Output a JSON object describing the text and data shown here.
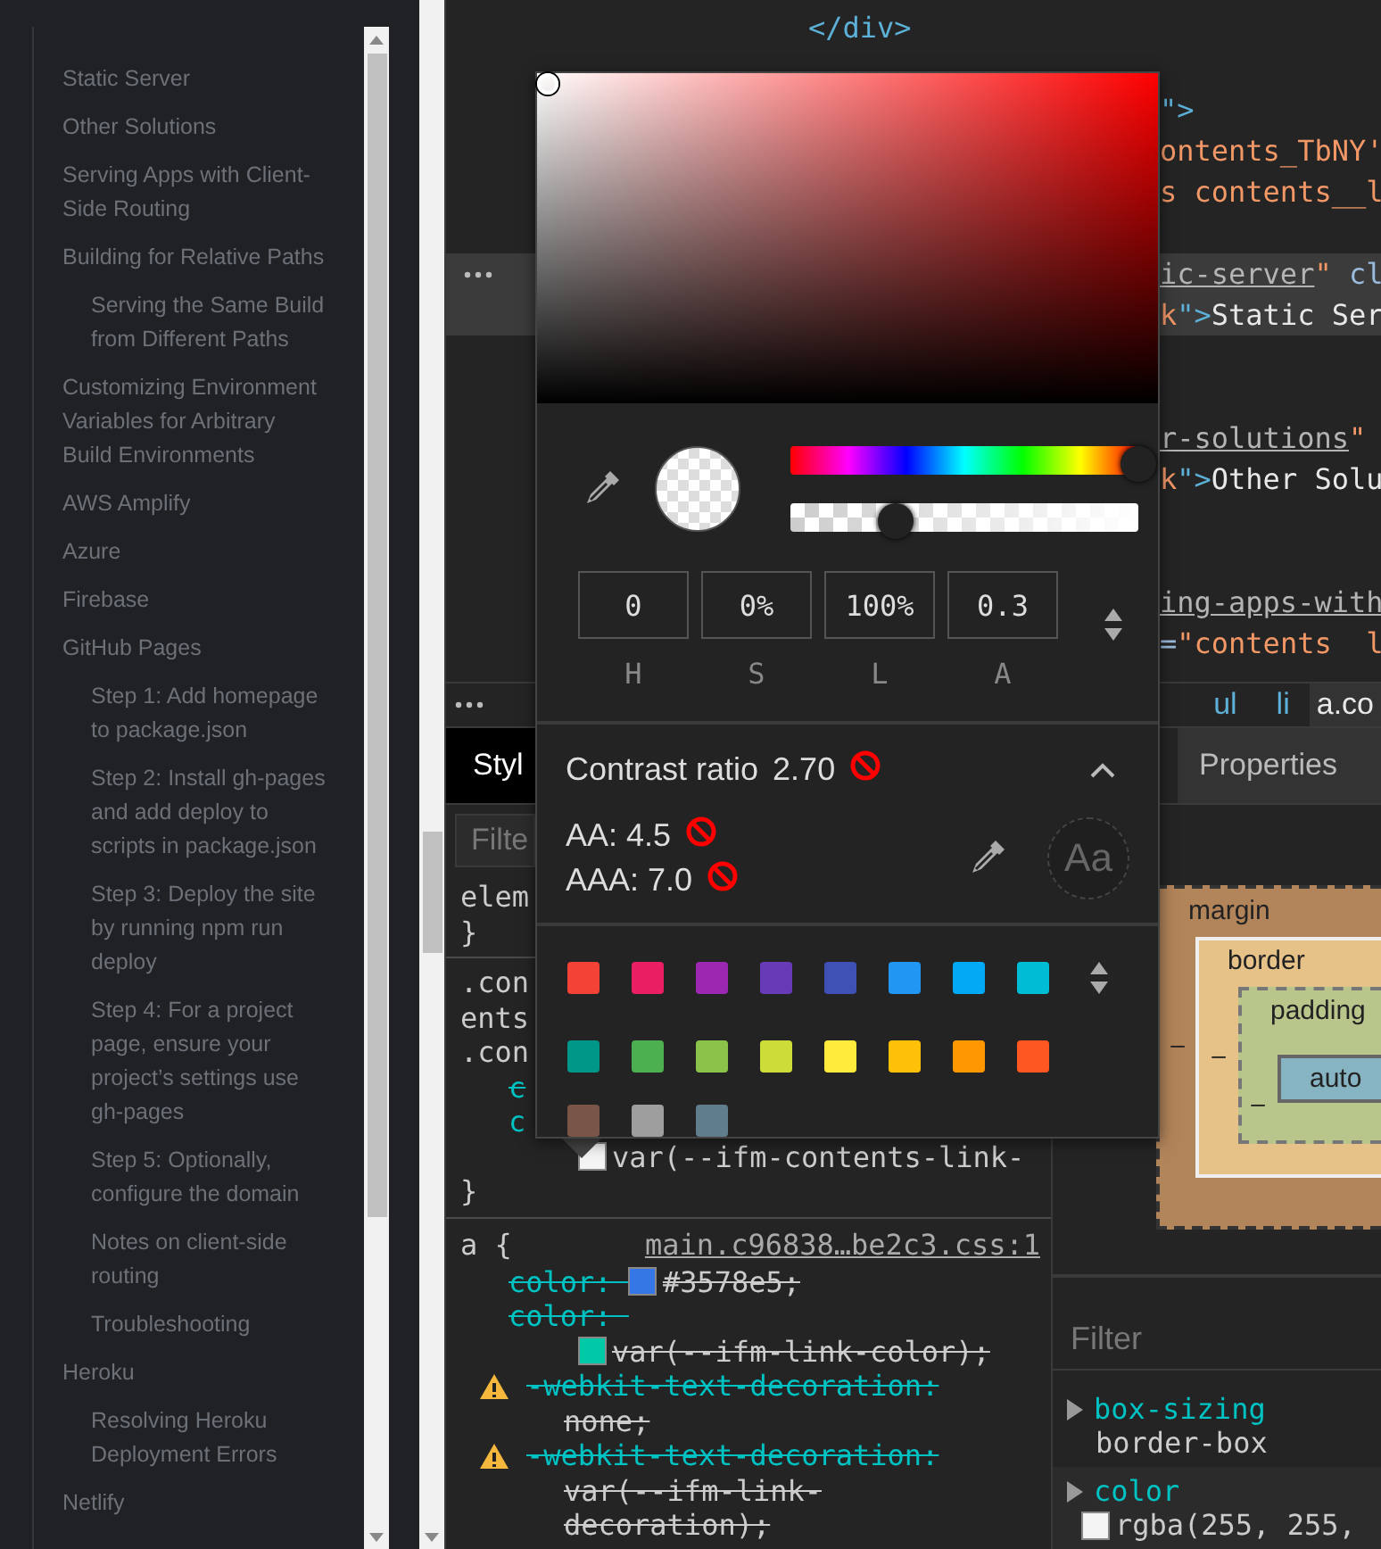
{
  "sidebar": {
    "items": [
      {
        "label": "Static Server"
      },
      {
        "label": "Other Solutions"
      },
      {
        "label": "Serving Apps with Client-Side Routing"
      },
      {
        "label": "Building for Relative Paths",
        "children": [
          {
            "label": "Serving the Same Build from Different Paths"
          }
        ]
      },
      {
        "label": "Customizing Environment Variables for Arbitrary Build Environments"
      },
      {
        "label": "AWS Amplify"
      },
      {
        "label": "Azure"
      },
      {
        "label": "Firebase"
      },
      {
        "label": "GitHub Pages",
        "children": [
          {
            "label": "Step 1: Add homepage to package.json"
          },
          {
            "label": "Step 2: Install gh-pages and add deploy to scripts in package.json"
          },
          {
            "label": "Step 3: Deploy the site by running npm run deploy"
          },
          {
            "label": "Step 4: For a project page, ensure your project’s settings use gh-pages"
          },
          {
            "label": "Step 5: Optionally, configure the domain"
          },
          {
            "label": "Notes on client-side routing"
          },
          {
            "label": "Troubleshooting"
          }
        ]
      },
      {
        "label": "Heroku",
        "children": [
          {
            "label": "Resolving Heroku Deployment Errors"
          }
        ]
      },
      {
        "label": "Netlify"
      }
    ]
  },
  "elements": {
    "lines": [
      {
        "kind": "close-inner",
        "selected": false,
        "parts": [
          {
            "kind": "tag",
            "text": "</div>"
          }
        ]
      },
      {
        "kind": "blank",
        "selected": false
      },
      {
        "kind": "tail",
        "selected": false,
        "parts": [
          {
            "kind": "tag",
            "text": "\">"
          }
        ]
      },
      {
        "kind": "tail",
        "selected": false,
        "parts": [
          {
            "kind": "value",
            "text": "ontents_TbNY'"
          }
        ]
      },
      {
        "kind": "tail",
        "selected": false,
        "parts": [
          {
            "kind": "value",
            "text": "s contents__l"
          }
        ]
      },
      {
        "kind": "blank",
        "selected": false
      },
      {
        "kind": "tail",
        "selected": true,
        "parts": [
          {
            "kind": "link",
            "text": "ic-server"
          },
          {
            "kind": "value",
            "text": "\""
          },
          {
            "kind": "attr",
            "text": " cl"
          }
        ]
      },
      {
        "kind": "tail",
        "selected": true,
        "parts": [
          {
            "kind": "value",
            "text": "k"
          },
          {
            "kind": "tag",
            "text": "\">"
          },
          {
            "kind": "text",
            "text": "Static Ser"
          }
        ]
      },
      {
        "kind": "blank",
        "selected": false
      },
      {
        "kind": "blank",
        "selected": false
      },
      {
        "kind": "tail",
        "selected": false,
        "parts": [
          {
            "kind": "link",
            "text": "r-solutions"
          },
          {
            "kind": "value",
            "text": "\""
          }
        ]
      },
      {
        "kind": "tail",
        "selected": false,
        "parts": [
          {
            "kind": "value",
            "text": "k"
          },
          {
            "kind": "tag",
            "text": "\">"
          },
          {
            "kind": "text",
            "text": "Other Solu"
          }
        ]
      },
      {
        "kind": "blank",
        "selected": false
      },
      {
        "kind": "blank",
        "selected": false
      },
      {
        "kind": "tail",
        "selected": false,
        "parts": [
          {
            "kind": "link",
            "text": "ing-apps-with"
          }
        ]
      },
      {
        "kind": "tail",
        "selected": false,
        "parts": [
          {
            "kind": "attr",
            "text": "="
          },
          {
            "kind": "value",
            "text": "\"contents  l"
          }
        ]
      }
    ]
  },
  "breadcrumbs": [
    {
      "label": "ul",
      "selected": false
    },
    {
      "label": "li",
      "selected": false
    },
    {
      "label": "a.co",
      "selected": true
    }
  ],
  "tabs": [
    {
      "label": "Styl",
      "selected": true
    },
    {
      "label": "Properties",
      "selected": false
    }
  ],
  "styles": {
    "filter": {
      "placeholder": "Filte"
    },
    "rules": [
      {
        "lines": [
          {
            "kind": "plain",
            "text": "elem"
          },
          {
            "kind": "plain",
            "text": "}"
          }
        ]
      },
      {
        "lines": [
          {
            "kind": "plain",
            "text": ".con"
          },
          {
            "kind": "plain",
            "text": "ents"
          },
          {
            "kind": "plain",
            "text": ".con"
          },
          {
            "kind": "prop",
            "struck": true,
            "text": "c"
          },
          {
            "kind": "prop",
            "struck": false,
            "text": "c"
          },
          {
            "kind": "value",
            "struck": false,
            "color": "#f4f4f4",
            "text": "var(--ifm-contents-link-"
          },
          {
            "kind": "plain",
            "text": "}"
          }
        ]
      },
      {
        "selector": "a {",
        "source": "main.c96838…be2c3.css:1",
        "lines": [
          {
            "kind": "prop",
            "struck": true,
            "text": "color: ",
            "color": "#3578e5",
            "value": "#3578e5;"
          },
          {
            "kind": "prop",
            "struck": true,
            "text": "color: "
          },
          {
            "kind": "value",
            "struck": true,
            "color": "#00c9a7",
            "text": "var(--ifm-link-color);"
          },
          {
            "kind": "prop",
            "struck": true,
            "warning": true,
            "text": "-webkit-text-decoration:"
          },
          {
            "kind": "value",
            "struck": true,
            "text": "none;"
          },
          {
            "kind": "prop",
            "struck": true,
            "warning": true,
            "text": "-webkit-text-decoration:"
          },
          {
            "kind": "value",
            "struck": true,
            "text": "var(--ifm-link-"
          },
          {
            "kind": "value",
            "struck": true,
            "text": "decoration);"
          }
        ]
      }
    ]
  },
  "box_model": {
    "margin": "margin",
    "border": "border",
    "padding": "padding",
    "content": "auto",
    "dashes": [
      "–",
      "–",
      "–"
    ]
  },
  "computed": {
    "filter": {
      "placeholder": "Filter"
    },
    "properties": [
      {
        "name": "box-sizing",
        "value": "border-box"
      },
      {
        "name": "color",
        "value": "rgba(255, 255,",
        "color": "#f4f4f4"
      }
    ]
  },
  "color_picker": {
    "hue": {
      "level": 1
    },
    "alpha": {
      "level": 0.3
    },
    "fields": [
      {
        "value": "0",
        "label": "H"
      },
      {
        "value": "0%",
        "label": "S"
      },
      {
        "value": "100%",
        "label": "L"
      },
      {
        "value": "0.3",
        "label": "A"
      }
    ],
    "contrast": {
      "title": "Contrast ratio",
      "ratio": "2.70",
      "passes": false,
      "expanded": true,
      "aa": "AA: 4.5",
      "aa_pass": false,
      "aaa": "AAA: 7.0",
      "aaa_pass": false,
      "sample": "Aa"
    },
    "swatches": [
      {
        "color": "#f44336"
      },
      {
        "color": "#e91e63"
      },
      {
        "color": "#9c27b0"
      },
      {
        "color": "#673ab7"
      },
      {
        "color": "#3f51b5"
      },
      {
        "color": "#2196f3"
      },
      {
        "color": "#03a9f4"
      },
      {
        "color": "#00bcd4"
      },
      {
        "color": "#009688"
      },
      {
        "color": "#4caf50"
      },
      {
        "color": "#8bc34a"
      },
      {
        "color": "#cddc39"
      },
      {
        "color": "#ffeb3b"
      },
      {
        "color": "#ffc107"
      },
      {
        "color": "#ff9800"
      },
      {
        "color": "#ff5722"
      },
      {
        "color": "#795548"
      },
      {
        "color": "#9e9e9e"
      },
      {
        "color": "#607d8b"
      }
    ]
  }
}
